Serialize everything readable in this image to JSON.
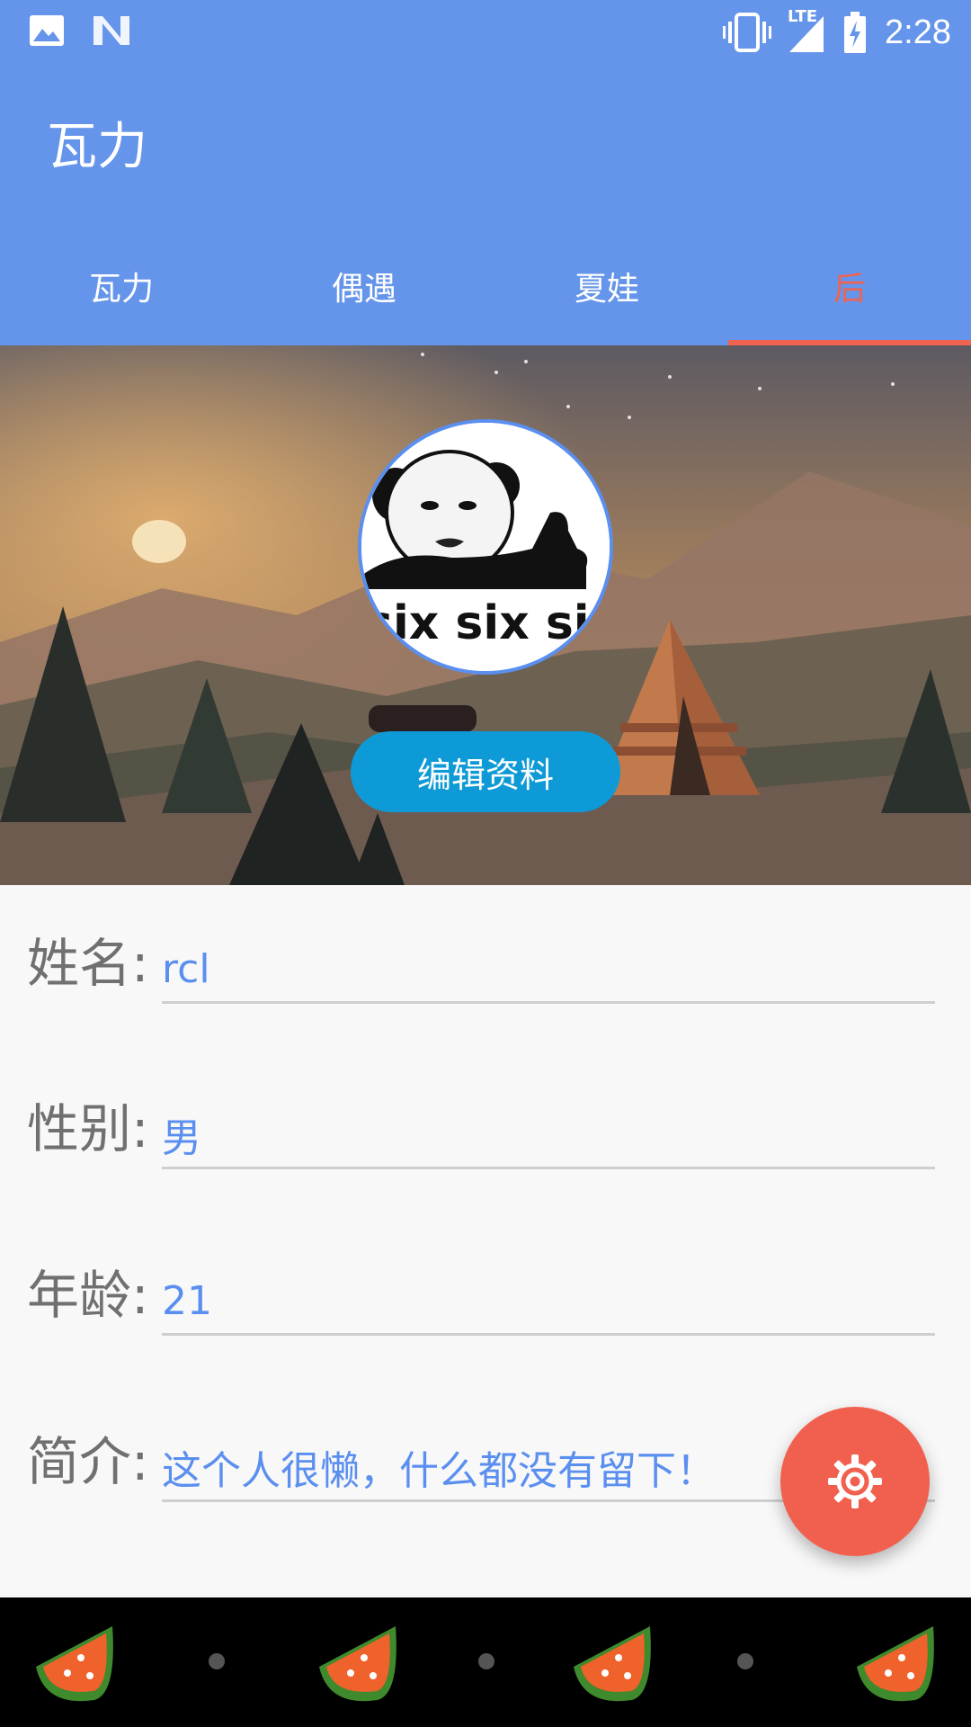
{
  "status_bar": {
    "time": "2:28",
    "network_label": "LTE",
    "icons": [
      "image-icon",
      "n-icon",
      "vibrate-icon",
      "signal-icon",
      "battery-charging-icon"
    ]
  },
  "app_bar": {
    "title": "瓦力"
  },
  "tabs": [
    {
      "label": "瓦力",
      "active": false
    },
    {
      "label": "偶遇",
      "active": false
    },
    {
      "label": "夏娃",
      "active": false
    },
    {
      "label": "后",
      "active": true
    }
  ],
  "profile": {
    "avatar_caption": "six six six",
    "edit_button": "编辑资料"
  },
  "fields": [
    {
      "label": "姓名:",
      "value": "rcl"
    },
    {
      "label": "性别:",
      "value": "男"
    },
    {
      "label": "年龄:",
      "value": "21"
    },
    {
      "label": "简介:",
      "value": "这个人很懒，什么都没有留下！"
    }
  ],
  "fab": {
    "icon": "gear-icon"
  },
  "colors": {
    "primary": "#6595ea",
    "accent": "#f06350",
    "button": "#0e9ad6",
    "value_text": "#5a8ff0",
    "fab": "#f1604e"
  }
}
